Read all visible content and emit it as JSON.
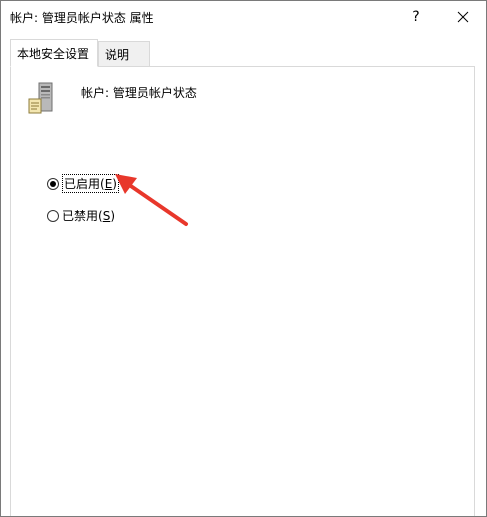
{
  "window": {
    "title": "帐户: 管理员帐户状态 属性",
    "help_label": "?",
    "close_icon": "close-icon"
  },
  "tabs": [
    {
      "label": "本地安全设置",
      "active": true
    },
    {
      "label": "说明",
      "active": false
    }
  ],
  "policy": {
    "icon": "server-icon",
    "name": "帐户: 管理员帐户状态"
  },
  "options": {
    "enabled": {
      "label_prefix": "已启用(",
      "mnemonic": "E",
      "label_suffix": ")",
      "selected": true
    },
    "disabled": {
      "label_prefix": "已禁用(",
      "mnemonic": "S",
      "label_suffix": ")",
      "selected": false
    }
  },
  "annotation": {
    "arrow_color": "#e8372b"
  }
}
